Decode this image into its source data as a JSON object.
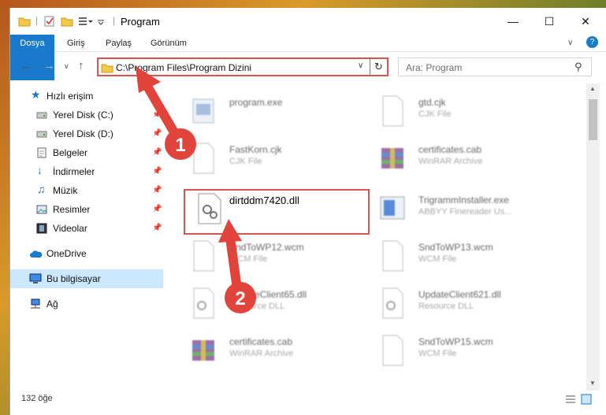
{
  "window": {
    "title": "Program"
  },
  "ribbon": {
    "tabs": [
      "Dosya",
      "Giriş",
      "Paylaş",
      "Görünüm"
    ]
  },
  "address": {
    "path": "C:\\Program Files\\Program Dizini"
  },
  "search": {
    "placeholder": "Ara: Program"
  },
  "sidebar": {
    "items": [
      {
        "label": "Hızlı erişim",
        "icon": "star-icon"
      },
      {
        "label": "Yerel Disk (C:)",
        "icon": "drive-icon",
        "pinned": true
      },
      {
        "label": "Yerel Disk (D:)",
        "icon": "drive-icon",
        "pinned": true
      },
      {
        "label": "Belgeler",
        "icon": "document-icon",
        "pinned": true
      },
      {
        "label": "İndirmeler",
        "icon": "download-icon",
        "pinned": true
      },
      {
        "label": "Müzik",
        "icon": "music-icon",
        "pinned": true
      },
      {
        "label": "Resimler",
        "icon": "picture-icon",
        "pinned": true
      },
      {
        "label": "Videolar",
        "icon": "video-icon",
        "pinned": true
      },
      {
        "label": "OneDrive",
        "icon": "cloud-icon"
      },
      {
        "label": "Bu bilgisayar",
        "icon": "computer-icon",
        "selected": true
      },
      {
        "label": "Ağ",
        "icon": "network-icon"
      }
    ]
  },
  "files": {
    "f0": {
      "name": "program.exe",
      "type": ""
    },
    "f1": {
      "name": "gtd.cjk",
      "type": "CJK File"
    },
    "f2": {
      "name": "FastKorn.cjk",
      "type": "CJK File"
    },
    "f3": {
      "name": "certificates.cab",
      "type": "WinRAR Archive"
    },
    "f4": {
      "name": "dirtddm7420.dll",
      "type": ""
    },
    "f5": {
      "name": "TrigrammInstaller.exe",
      "type": "ABBYY Finereader Us..."
    },
    "f6": {
      "name": "SndToWP12.wcm",
      "type": "WCM File"
    },
    "f7": {
      "name": "SndToWP13.wcm",
      "type": "WCM File"
    },
    "f8": {
      "name": "UpdateClient65.dll",
      "type": "Resource DLL"
    },
    "f9": {
      "name": "UpdateClient621.dll",
      "type": "Resource DLL"
    },
    "f10": {
      "name": "certificates.cab",
      "type": "WinRAR Archive"
    },
    "f11": {
      "name": "SndToWP15.wcm",
      "type": "WCM File"
    }
  },
  "status": {
    "count": "132 öğe"
  },
  "annotations": {
    "step1": "1",
    "step2": "2"
  },
  "colors": {
    "accent": "#1979ca",
    "highlight": "#d9534f",
    "selected": "#cce8ff"
  }
}
